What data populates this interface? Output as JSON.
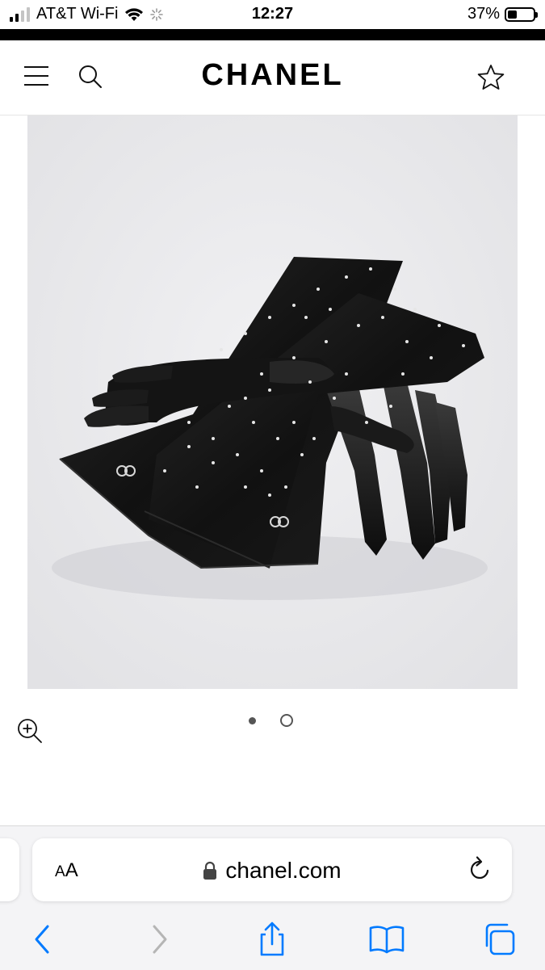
{
  "status_bar": {
    "carrier": "AT&T Wi-Fi",
    "time": "12:27",
    "battery": "37%",
    "battery_level": 0.37
  },
  "header": {
    "brand": "CHANEL",
    "icons": [
      "menu-icon",
      "search-icon",
      "star-icon"
    ]
  },
  "gallery": {
    "dots": [
      "active",
      "inactive"
    ],
    "zoom_icon": "zoom-in-icon"
  },
  "browser": {
    "text_size": "A",
    "text_size_large": "A",
    "domain": "chanel.com",
    "icons": [
      "lock-icon",
      "reload-icon",
      "back-icon",
      "forward-icon",
      "share-icon",
      "bookmarks-icon",
      "tabs-icon"
    ]
  },
  "colors": {
    "accent": "#007aff",
    "disabled": "#b5b5b5",
    "photo_bg": "#ececee"
  }
}
